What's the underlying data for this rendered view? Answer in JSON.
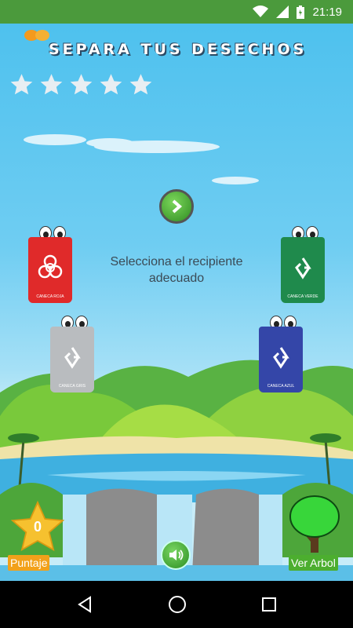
{
  "status_bar": {
    "time": "21:19"
  },
  "game": {
    "title": "SEPARA TUS DESECHOS",
    "stars_total": 5,
    "instruction": "Selecciona el recipiente adecuado",
    "bins": [
      {
        "id": "roja",
        "label": "CANECA ROJA",
        "color": "#e02a2a",
        "icon": "biohazard-icon"
      },
      {
        "id": "verde",
        "label": "CANECA VERDE",
        "color": "#1f8a4c",
        "icon": "recycle-icon"
      },
      {
        "id": "gris",
        "label": "CANECA GRIS",
        "color": "#b9bcbf",
        "icon": "recycle-icon"
      },
      {
        "id": "azul",
        "label": "CANECA AZUL",
        "color": "#3446a8",
        "icon": "recycle-icon"
      }
    ],
    "score": {
      "value": "0",
      "label": "Puntaje"
    },
    "tree_button_label": "Ver Arbol"
  }
}
